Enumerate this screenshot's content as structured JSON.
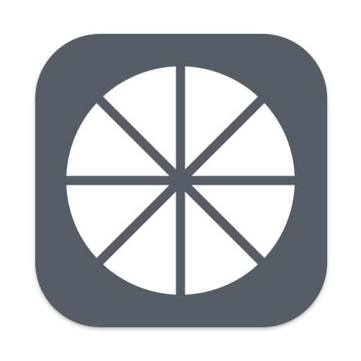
{
  "icon": {
    "name": "wheel-icon",
    "segments": 8,
    "colors": {
      "tile": "#575d66",
      "glyph": "#ffffff",
      "page_background": "#ffffff"
    }
  }
}
